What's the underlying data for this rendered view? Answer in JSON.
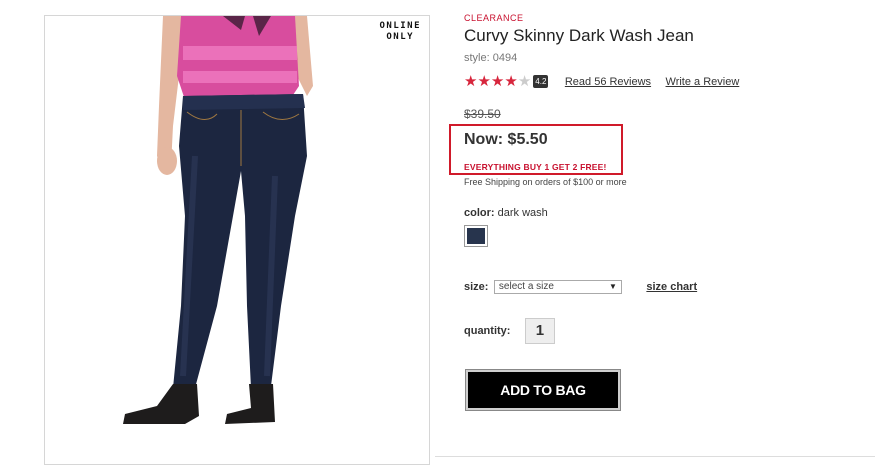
{
  "product_image": {
    "badge_line1": "ONLINE",
    "badge_line2": "ONLY"
  },
  "product": {
    "tag": "CLEARANCE",
    "title": "Curvy Skinny Dark Wash Jean",
    "style": "style: 0494",
    "rating": 4.2,
    "rating_badge": "4.2",
    "read_reviews": "Read 56 Reviews",
    "write_review": "Write a Review",
    "was_price": "$39.50",
    "now_price": "Now: $5.50",
    "promo": "EVERYTHING BUY 1 GET 2 FREE!",
    "shipping": "Free Shipping on orders of $100 or more",
    "color_label": "color:",
    "color_value": "dark wash",
    "swatch_color": "#27344d",
    "size_label": "size:",
    "size_placeholder": "select a size",
    "size_chart": "size chart",
    "quantity_label": "quantity:",
    "quantity_value": "1",
    "add_to_bag": "ADD TO BAG"
  },
  "colors": {
    "accent_red": "#c8102e",
    "highlight_box": "#d01a2a",
    "button_bg": "#000000"
  }
}
